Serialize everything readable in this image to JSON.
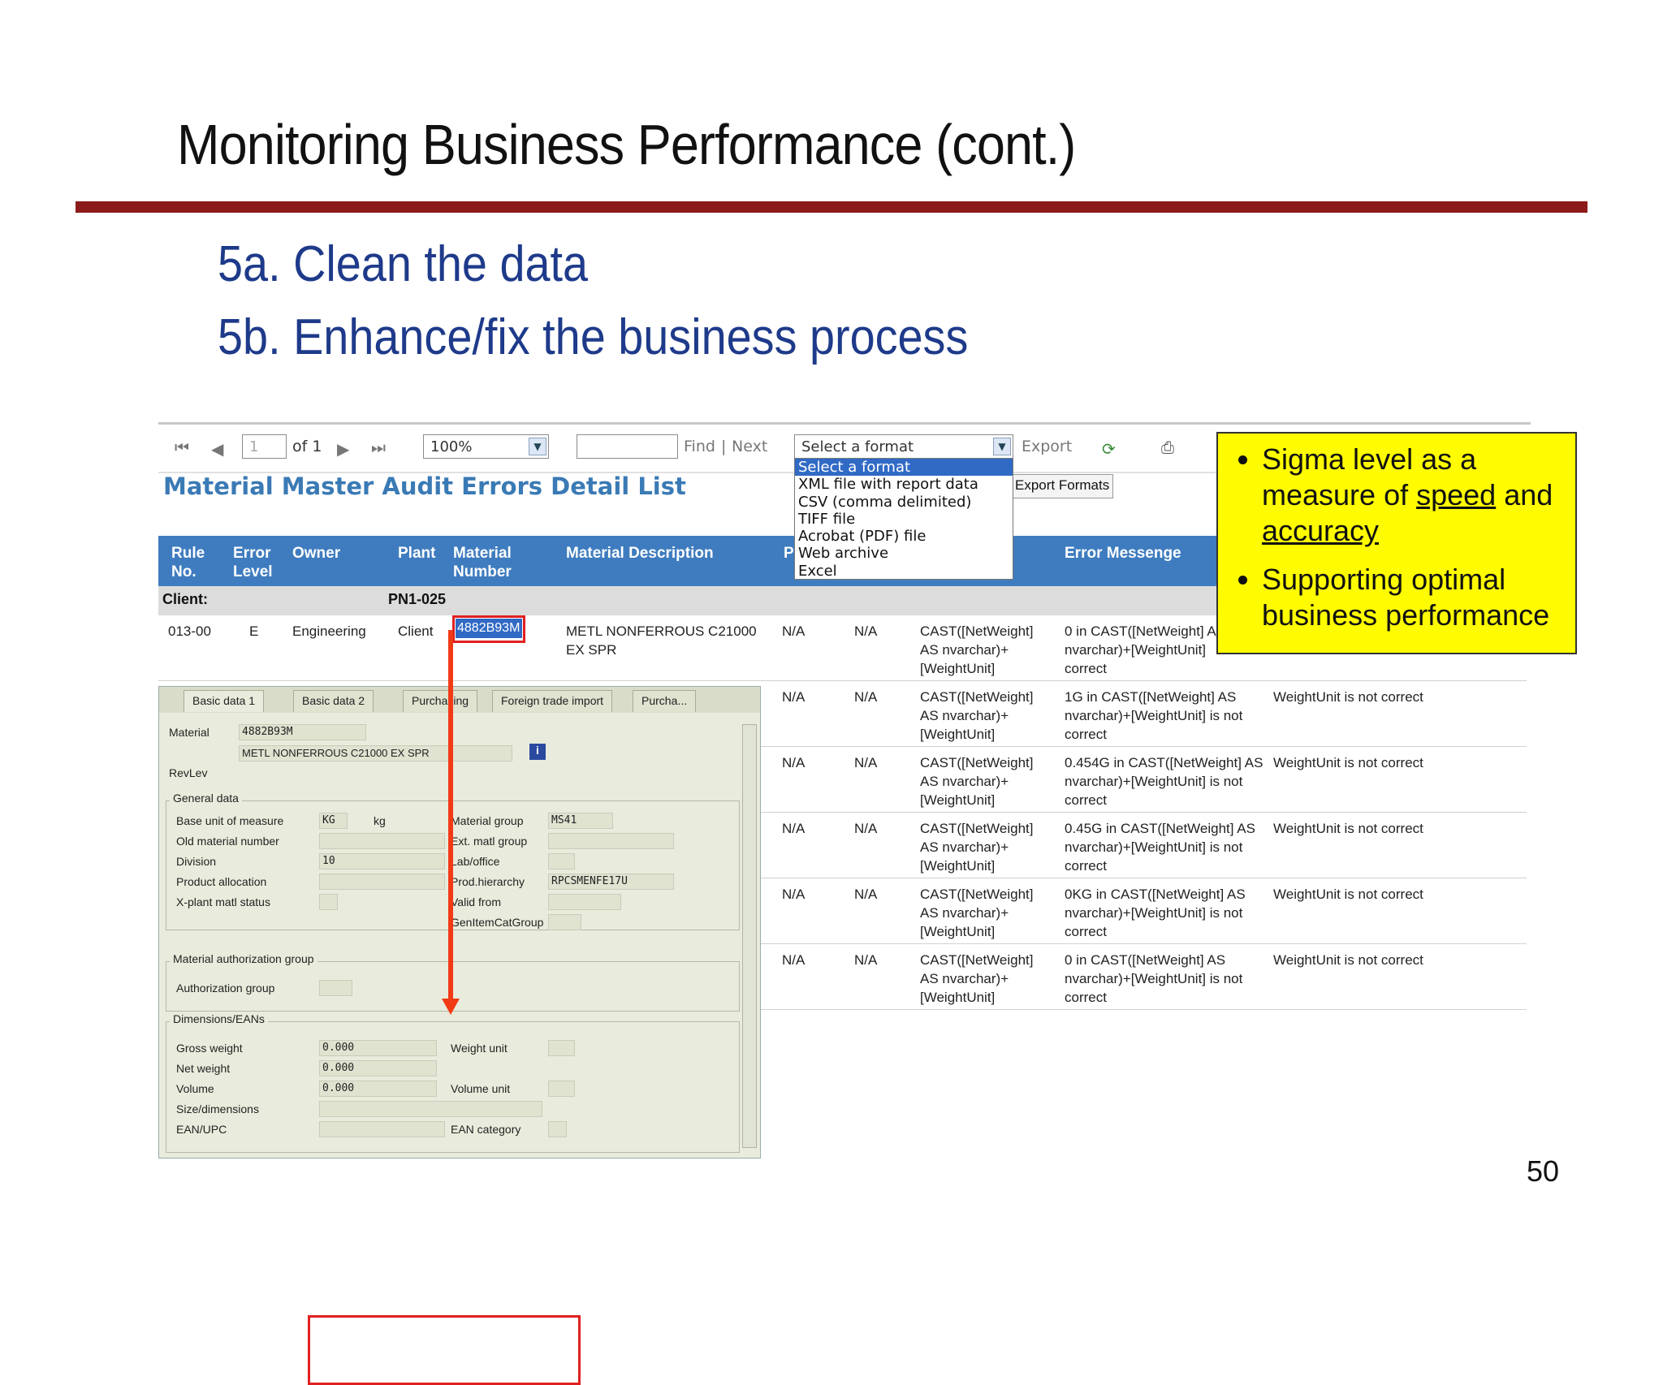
{
  "slide": {
    "title": "Monitoring Business Performance (cont.)",
    "subhead_a": "5a. Clean the data",
    "subhead_b": "5b. Enhance/fix the business process",
    "page_number": "50"
  },
  "toolbar": {
    "page_value": "1",
    "of_label": "of 1",
    "zoom": "100%",
    "find_label": "Find",
    "separator": "|",
    "next_label": "Next",
    "format_select": "Select a format",
    "export_label": "Export"
  },
  "format_options": [
    "Select a format",
    "XML file with report data",
    "CSV (comma delimited)",
    "TIFF file",
    "Acrobat (PDF) file",
    "Web archive",
    "Excel"
  ],
  "report": {
    "title": "Material Master Audit Errors Detail List",
    "export_formats_label": "Export Formats",
    "columns": [
      "Rule No.",
      "Error Level",
      "Owner",
      "Plant",
      "Material Number",
      "Material Description",
      "P",
      "Error Messenge"
    ],
    "client_label": "Client:",
    "client_value": "PN1-025",
    "rows": [
      {
        "rule": "013-00",
        "level": "E",
        "owner": "Engineering",
        "plant": "Client",
        "material": "4882B93M",
        "desc": "METL NONFERROUS C21000 EX SPR",
        "p": "N/A",
        "q": "N/A",
        "expr": "CAST([NetWeight] AS nvarchar)+ [WeightUnit]",
        "msg": "0 in CAST([NetWeight] A nvarchar)+[WeightUnit] correct",
        "msg2": ""
      },
      {
        "p": "N/A",
        "q": "N/A",
        "expr": "CAST([NetWeight] AS nvarchar)+ [WeightUnit]",
        "msg": "1G in CAST([NetWeight] AS nvarchar)+[WeightUnit] is not correct",
        "msg2": "WeightUnit is not correct"
      },
      {
        "p": "N/A",
        "q": "N/A",
        "expr": "CAST([NetWeight] AS nvarchar)+ [WeightUnit]",
        "msg": "0.454G in CAST([NetWeight] AS nvarchar)+[WeightUnit] is not correct",
        "msg2": "WeightUnit is not correct"
      },
      {
        "p": "N/A",
        "q": "N/A",
        "expr": "CAST([NetWeight] AS nvarchar)+ [WeightUnit]",
        "msg": "0.45G in CAST([NetWeight] AS nvarchar)+[WeightUnit] is not correct",
        "msg2": "WeightUnit is not correct"
      },
      {
        "p": "N/A",
        "q": "N/A",
        "expr": "CAST([NetWeight] AS nvarchar)+ [WeightUnit]",
        "msg": "0KG in CAST([NetWeight] AS nvarchar)+[WeightUnit] is not correct",
        "msg2": "WeightUnit is not correct"
      },
      {
        "p": "N/A",
        "q": "N/A",
        "expr": "CAST([NetWeight] AS nvarchar)+ [WeightUnit]",
        "msg": "0 in CAST([NetWeight] AS nvarchar)+[WeightUnit] is not correct",
        "msg2": "WeightUnit is not correct"
      }
    ]
  },
  "sap": {
    "tabs": [
      "Basic data 1",
      "Basic data 2",
      "Purchasing",
      "Foreign trade import",
      "Purcha..."
    ],
    "material_label": "Material",
    "material_value": "4882B93M",
    "description_value": "METL NONFERROUS C21000 EX SPR",
    "revlev_label": "RevLev",
    "general_title": "General data",
    "base_uom_label": "Base unit of measure",
    "base_uom_value": "KG",
    "base_uom_text": "kg",
    "old_material_label": "Old material number",
    "division_label": "Division",
    "division_value": "10",
    "product_alloc_label": "Product allocation",
    "xplant_label": "X-plant matl status",
    "material_group_label": "Material group",
    "material_group_value": "MS41",
    "ext_group_label": "Ext. matl group",
    "lab_office_label": "Lab/office",
    "prod_hier_label": "Prod.hierarchy",
    "prod_hier_value": "RPCSMENFE17U",
    "valid_from_label": "Valid from",
    "gen_item_label": "GenItemCatGroup",
    "auth_title": "Material authorization group",
    "auth_label": "Authorization group",
    "dims_title": "Dimensions/EANs",
    "gross_label": "Gross weight",
    "gross_value": "0.000",
    "net_label": "Net weight",
    "net_value": "0.000",
    "volume_label": "Volume",
    "volume_value": "0.000",
    "weight_unit_label": "Weight unit",
    "volume_unit_label": "Volume unit",
    "size_label": "Size/dimensions",
    "ean_label": "EAN/UPC",
    "ean_cat_label": "EAN category"
  },
  "callout": {
    "b1_pre": "Sigma level as a measure of ",
    "b1_speed": "speed",
    "b1_mid": " and ",
    "b1_accuracy": "accuracy",
    "b2": "Supporting optimal business performance"
  }
}
